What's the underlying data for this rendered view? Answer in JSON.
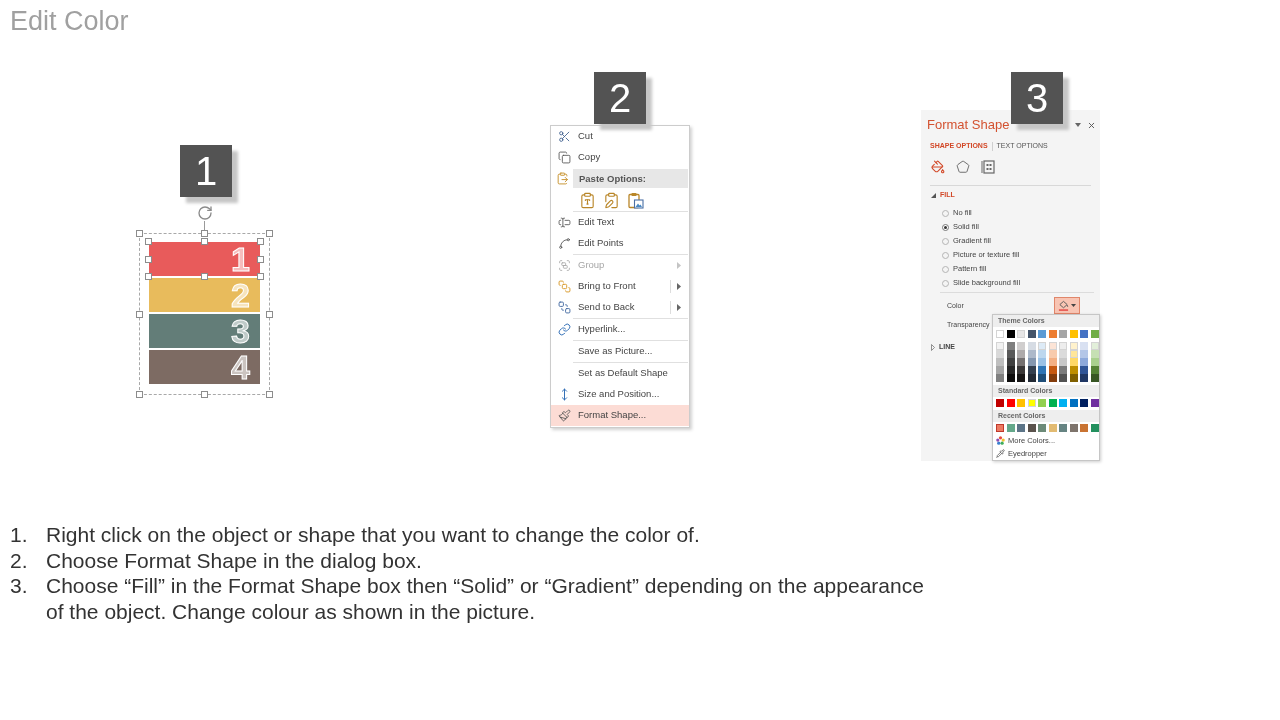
{
  "title": "Edit Color",
  "figures": [
    {
      "kind": "shape",
      "badge": "1",
      "shape_group": {
        "selected": true,
        "bars": [
          {
            "label": "1",
            "color": "#e85b5b",
            "selected": true
          },
          {
            "label": "2",
            "color": "#e8bb5c",
            "selected": false
          },
          {
            "label": "3",
            "color": "#637d78",
            "selected": false
          },
          {
            "label": "4",
            "color": "#7d6b63",
            "selected": false
          }
        ]
      }
    },
    {
      "kind": "context_menu",
      "badge": "2",
      "menu": {
        "groups": [
          {
            "items": [
              {
                "kind": "command",
                "label": "Cut",
                "disabled": false,
                "submenu": false,
                "split": false,
                "selected": false
              },
              {
                "kind": "command",
                "label": "Copy",
                "disabled": false,
                "submenu": false,
                "split": false,
                "selected": false
              },
              {
                "kind": "header",
                "label": "Paste Options:"
              },
              {
                "kind": "paste_icons"
              }
            ]
          },
          {
            "items": [
              {
                "kind": "command",
                "label": "Edit Text",
                "disabled": false,
                "submenu": false,
                "split": false,
                "selected": false
              },
              {
                "kind": "command",
                "label": "Edit Points",
                "disabled": false,
                "submenu": false,
                "split": false,
                "selected": false
              }
            ]
          },
          {
            "items": [
              {
                "kind": "command",
                "label": "Group",
                "disabled": true,
                "submenu": true,
                "split": false,
                "selected": false
              },
              {
                "kind": "command",
                "label": "Bring to Front",
                "disabled": false,
                "submenu": true,
                "split": true,
                "selected": false
              },
              {
                "kind": "command",
                "label": "Send to Back",
                "disabled": false,
                "submenu": true,
                "split": true,
                "selected": false
              }
            ]
          },
          {
            "items": [
              {
                "kind": "command",
                "label": "Hyperlink...",
                "disabled": false,
                "submenu": false,
                "split": false,
                "selected": false
              }
            ]
          },
          {
            "items": [
              {
                "kind": "command",
                "label": "Save as Picture...",
                "disabled": false,
                "submenu": false,
                "split": false,
                "selected": false
              }
            ]
          },
          {
            "items": [
              {
                "kind": "command",
                "label": "Set as Default Shape",
                "disabled": false,
                "submenu": false,
                "split": false,
                "selected": false
              },
              {
                "kind": "command",
                "label": "Size and Position...",
                "disabled": false,
                "submenu": false,
                "split": false,
                "selected": false
              },
              {
                "kind": "command",
                "label": "Format Shape...",
                "disabled": false,
                "submenu": false,
                "split": false,
                "selected": true
              }
            ]
          }
        ]
      }
    },
    {
      "kind": "format_pane",
      "badge": "3",
      "pane": {
        "title": "Format Shape",
        "tabs": [
          {
            "label": "SHAPE OPTIONS",
            "selected": true
          },
          {
            "label": "TEXT OPTIONS",
            "selected": false
          }
        ],
        "icon_tabs": [
          {
            "kind": "fill",
            "selected": true
          },
          {
            "kind": "effects",
            "selected": false
          },
          {
            "kind": "size",
            "selected": false
          }
        ],
        "sections": [
          {
            "label": "FILL",
            "expanded": true,
            "options": [
              {
                "label": "No fill",
                "selected": false
              },
              {
                "label": "Solid fill",
                "selected": true
              },
              {
                "label": "Gradient fill",
                "selected": false
              },
              {
                "label": "Picture or texture fill",
                "selected": false
              },
              {
                "label": "Pattern fill",
                "selected": false
              },
              {
                "label": "Slide background fill",
                "selected": false
              }
            ],
            "properties": [
              {
                "label": "Color",
                "kind": "color",
                "open": true,
                "menu": {
                  "groups": [
                    {
                      "title": "Theme Colors",
                      "kind": "theme",
                      "columns": [
                        {
                          "color": "#ffffff",
                          "shades": [
                            {
                              "color": "#f2f2f2"
                            },
                            {
                              "color": "#d9d9d9"
                            },
                            {
                              "color": "#bfbfbf"
                            },
                            {
                              "color": "#a6a6a6"
                            },
                            {
                              "color": "#808080"
                            }
                          ]
                        },
                        {
                          "color": "#000000",
                          "shades": [
                            {
                              "color": "#7f7f7f"
                            },
                            {
                              "color": "#595959"
                            },
                            {
                              "color": "#404040"
                            },
                            {
                              "color": "#262626"
                            },
                            {
                              "color": "#0d0d0d"
                            }
                          ]
                        },
                        {
                          "color": "#e7e6e6",
                          "shades": [
                            {
                              "color": "#d0cece"
                            },
                            {
                              "color": "#aeaaaa"
                            },
                            {
                              "color": "#757171"
                            },
                            {
                              "color": "#3a3838"
                            },
                            {
                              "color": "#171616"
                            }
                          ]
                        },
                        {
                          "color": "#44546a",
                          "shades": [
                            {
                              "color": "#d6dce4"
                            },
                            {
                              "color": "#adb9ca"
                            },
                            {
                              "color": "#8497b0"
                            },
                            {
                              "color": "#333f4f"
                            },
                            {
                              "color": "#222a35"
                            }
                          ]
                        },
                        {
                          "color": "#5b9bd5",
                          "shades": [
                            {
                              "color": "#ddebf7"
                            },
                            {
                              "color": "#bdd7ee"
                            },
                            {
                              "color": "#9bc2e6"
                            },
                            {
                              "color": "#2f75b5"
                            },
                            {
                              "color": "#1f4e78"
                            }
                          ]
                        },
                        {
                          "color": "#ed7d31",
                          "shades": [
                            {
                              "color": "#fce4d6"
                            },
                            {
                              "color": "#f8cbad"
                            },
                            {
                              "color": "#f4b084"
                            },
                            {
                              "color": "#c65911"
                            },
                            {
                              "color": "#833c0c"
                            }
                          ]
                        },
                        {
                          "color": "#a5a5a5",
                          "shades": [
                            {
                              "color": "#ededed"
                            },
                            {
                              "color": "#dbdbdb"
                            },
                            {
                              "color": "#c9c9c9"
                            },
                            {
                              "color": "#7b7b7b"
                            },
                            {
                              "color": "#525252"
                            }
                          ]
                        },
                        {
                          "color": "#ffc000",
                          "shades": [
                            {
                              "color": "#fff2cc"
                            },
                            {
                              "color": "#ffe699"
                            },
                            {
                              "color": "#ffd966"
                            },
                            {
                              "color": "#bf8f00"
                            },
                            {
                              "color": "#806000"
                            }
                          ]
                        },
                        {
                          "color": "#4472c4",
                          "shades": [
                            {
                              "color": "#d9e1f2"
                            },
                            {
                              "color": "#b4c6e7"
                            },
                            {
                              "color": "#8ea9db"
                            },
                            {
                              "color": "#305496"
                            },
                            {
                              "color": "#203764"
                            }
                          ]
                        },
                        {
                          "color": "#70ad47",
                          "shades": [
                            {
                              "color": "#e2efda"
                            },
                            {
                              "color": "#c6e0b4"
                            },
                            {
                              "color": "#a9d08e"
                            },
                            {
                              "color": "#548235"
                            },
                            {
                              "color": "#375623"
                            }
                          ]
                        }
                      ]
                    },
                    {
                      "title": "Standard Colors",
                      "kind": "row",
                      "swatches": [
                        {
                          "color": "#c00000"
                        },
                        {
                          "color": "#ff0000"
                        },
                        {
                          "color": "#ffc000"
                        },
                        {
                          "color": "#ffff00"
                        },
                        {
                          "color": "#92d050"
                        },
                        {
                          "color": "#00b050"
                        },
                        {
                          "color": "#00b0f0"
                        },
                        {
                          "color": "#0070c0"
                        },
                        {
                          "color": "#002060"
                        },
                        {
                          "color": "#7030a0"
                        }
                      ]
                    },
                    {
                      "title": "Recent Colors",
                      "kind": "row",
                      "swatches": [
                        {
                          "color": "#ec7a62",
                          "selected": true
                        },
                        {
                          "color": "#64a88a",
                          "selected": false
                        },
                        {
                          "color": "#5c7487",
                          "selected": false
                        },
                        {
                          "color": "#5a524c",
                          "selected": false
                        },
                        {
                          "color": "#6c8a78",
                          "selected": false
                        },
                        {
                          "color": "#e2bb72",
                          "selected": false
                        },
                        {
                          "color": "#668482",
                          "selected": false
                        },
                        {
                          "color": "#7e746c",
                          "selected": false
                        },
                        {
                          "color": "#c97332",
                          "selected": false
                        },
                        {
                          "color": "#23905e",
                          "selected": false
                        }
                      ]
                    }
                  ],
                  "actions": [
                    {
                      "label": "More Colors..."
                    },
                    {
                      "label": "Eyedropper"
                    }
                  ]
                }
              },
              {
                "label": "Transparency",
                "kind": "plain"
              }
            ]
          },
          {
            "label": "LINE",
            "expanded": false
          }
        ]
      }
    }
  ],
  "instructions": [
    {
      "number": "1.",
      "text": "Right click on the object or shape that you want to change the color of."
    },
    {
      "number": "2.",
      "text": "Choose Format Shape in the dialog box."
    },
    {
      "number": "3.",
      "text": "Choose “Fill” in the Format Shape box then “Solid” or “Gradient” depending on the appearance of the object. Change colour as shown in the picture."
    }
  ]
}
